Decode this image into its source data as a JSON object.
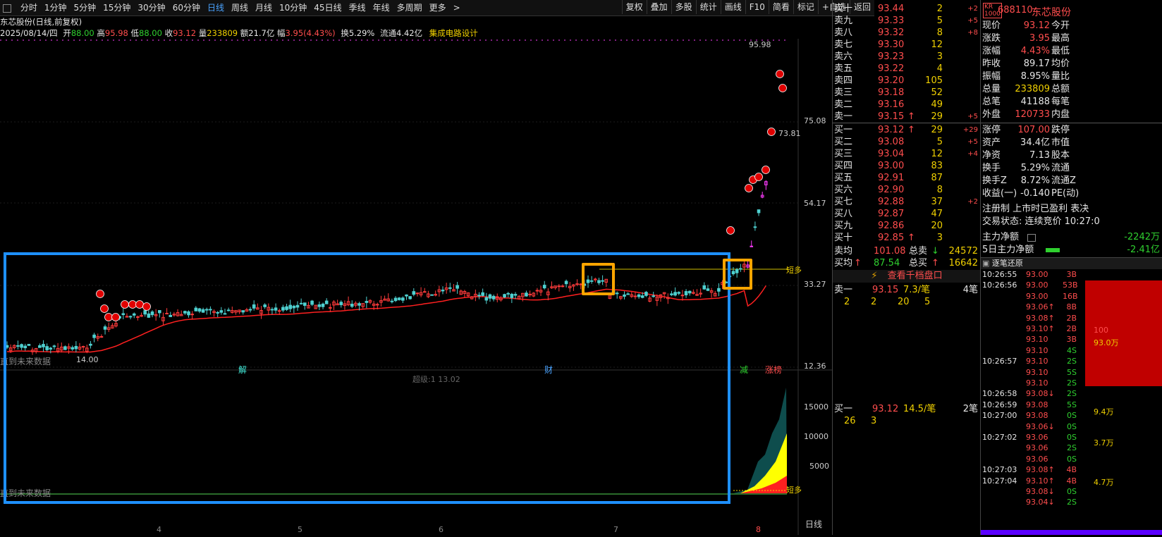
{
  "toolbar": {
    "timeframes": [
      "分时",
      "1分钟",
      "5分钟",
      "15分钟",
      "30分钟",
      "60分钟",
      "日线",
      "周线",
      "月线",
      "10分钟",
      "45日线",
      "季线",
      "年线",
      "多周期",
      "更多"
    ],
    "active_timeframe": "日线",
    "more_arrow": ">",
    "buttons": [
      "复权",
      "叠加",
      "多股",
      "统计",
      "画线",
      "F10",
      "简看",
      "标记",
      "+自选",
      "返回"
    ]
  },
  "info": {
    "stock_title": "东芯股份(日线,前复权)",
    "date": "2025/08/14/四",
    "open_label": "开",
    "open": "88.00",
    "high_label": "高",
    "high": "95.98",
    "low_label": "低",
    "low": "88.00",
    "close_label": "收",
    "close": "93.12",
    "vol_label": "量",
    "vol": "233809",
    "amount_label": "额",
    "amount": "21.7亿",
    "change_label": "幅",
    "change": "3.95(4.43%)",
    "turnover_label": "换",
    "turnover": "5.29%",
    "float_label": "流通",
    "float": "4.42亿",
    "industry": "集成电路设计"
  },
  "chart": {
    "price_ticks": [
      "75.08",
      "54.17",
      "33.27",
      "12.36"
    ],
    "vol_ticks": [
      "15000",
      "10000",
      "5000"
    ],
    "high_label": "95.98",
    "low_label": "14.00",
    "mark_price": "73.81",
    "future_data": "直到未来数据",
    "future_data2": "直到未来数据",
    "event_labels": [
      "解",
      "财",
      "减",
      "涨榜"
    ],
    "overlay_right": "短多",
    "overlay_right2": "短多",
    "vol_indicator": "超级:1 13.02",
    "period_label": "日线",
    "x_ticks": [
      "4",
      "5",
      "6",
      "7",
      "8"
    ],
    "candle_badge": "拒",
    "colors": {
      "up": "#ff3b3b",
      "down": "#2fd02f",
      "magenta": "#ff3bff",
      "ma": "#ff2020",
      "highlight_blue": "#1e90ff",
      "highlight_orange": "#ffa500",
      "area_dark": "#0e4d4d",
      "area_yellow": "#ffff00",
      "area_red": "#ff2020"
    }
  },
  "orderbook": {
    "asks": [
      {
        "label": "卖十",
        "price": "93.44",
        "vol": "2",
        "chg": "+2",
        "arrow": ""
      },
      {
        "label": "卖九",
        "price": "93.33",
        "vol": "5",
        "chg": "+5",
        "arrow": ""
      },
      {
        "label": "卖八",
        "price": "93.32",
        "vol": "8",
        "chg": "+8",
        "arrow": ""
      },
      {
        "label": "卖七",
        "price": "93.30",
        "vol": "12",
        "chg": "",
        "arrow": ""
      },
      {
        "label": "卖六",
        "price": "93.23",
        "vol": "3",
        "chg": "",
        "arrow": ""
      },
      {
        "label": "卖五",
        "price": "93.22",
        "vol": "4",
        "chg": "",
        "arrow": ""
      },
      {
        "label": "卖四",
        "price": "93.20",
        "vol": "105",
        "chg": "",
        "arrow": ""
      },
      {
        "label": "卖三",
        "price": "93.18",
        "vol": "52",
        "chg": "",
        "arrow": ""
      },
      {
        "label": "卖二",
        "price": "93.16",
        "vol": "49",
        "chg": "",
        "arrow": ""
      },
      {
        "label": "卖一",
        "price": "93.15",
        "vol": "29",
        "chg": "+5",
        "arrow": "↑"
      }
    ],
    "bids": [
      {
        "label": "买一",
        "price": "93.12",
        "vol": "29",
        "chg": "+29",
        "arrow": "↑"
      },
      {
        "label": "买二",
        "price": "93.08",
        "vol": "5",
        "chg": "+5",
        "arrow": ""
      },
      {
        "label": "买三",
        "price": "93.04",
        "vol": "12",
        "chg": "+4",
        "arrow": ""
      },
      {
        "label": "买四",
        "price": "93.00",
        "vol": "83",
        "chg": "",
        "arrow": ""
      },
      {
        "label": "买五",
        "price": "92.91",
        "vol": "87",
        "chg": "",
        "arrow": ""
      },
      {
        "label": "买六",
        "price": "92.90",
        "vol": "8",
        "chg": "",
        "arrow": ""
      },
      {
        "label": "买七",
        "price": "92.88",
        "vol": "37",
        "chg": "+2",
        "arrow": ""
      },
      {
        "label": "买八",
        "price": "92.87",
        "vol": "47",
        "chg": "",
        "arrow": ""
      },
      {
        "label": "买九",
        "price": "92.86",
        "vol": "20",
        "chg": "",
        "arrow": ""
      },
      {
        "label": "买十",
        "price": "92.85",
        "vol": "3",
        "chg": "",
        "arrow": "↑"
      }
    ],
    "ask_avg_label": "卖均",
    "ask_avg": "101.08",
    "total_sell_label": "总卖",
    "total_sell": "24572",
    "bid_avg_label": "买均",
    "bid_avg": "87.54",
    "total_buy_label": "总买",
    "total_buy": "16642",
    "view_thousand": "查看千档盘口",
    "sell1_label": "卖一",
    "sell1_price": "93.15",
    "sell1_per": "7.3/笔",
    "sell1_count": "4笔",
    "sell1_queue": [
      "2",
      "2",
      "20",
      "5"
    ],
    "buy1_label": "买一",
    "buy1_price": "93.12",
    "buy1_per": "14.5/笔",
    "buy1_count": "2笔",
    "buy1_queue": [
      "26",
      "3"
    ]
  },
  "right": {
    "badge_top": "KR",
    "badge_bottom": "1000",
    "code": "688110",
    "name": "东芯股份",
    "rows": [
      {
        "l": "现价",
        "v": "93.12",
        "vc": "red",
        "r": "今开"
      },
      {
        "l": "涨跌",
        "v": "3.95",
        "vc": "red",
        "r": "最高"
      },
      {
        "l": "涨幅",
        "v": "4.43%",
        "vc": "red",
        "r": "最低"
      },
      {
        "l": "昨收",
        "v": "89.17",
        "vc": "white",
        "r": "均价"
      },
      {
        "l": "振幅",
        "v": "8.95%",
        "vc": "white",
        "r": "量比"
      },
      {
        "l": "总量",
        "v": "233809",
        "vc": "yellow",
        "r": "总额"
      },
      {
        "l": "总笔",
        "v": "41188",
        "vc": "white",
        "r": "每笔"
      },
      {
        "l": "外盘",
        "v": "120733",
        "vc": "red",
        "r": "内盘"
      }
    ],
    "rows2": [
      {
        "l": "涨停",
        "v": "107.00",
        "vc": "red",
        "r": "跌停"
      },
      {
        "l": "资产",
        "v": "34.4亿",
        "vc": "white",
        "r": "市值"
      },
      {
        "l": "净资",
        "v": "7.13",
        "vc": "white",
        "r": "股本"
      },
      {
        "l": "换手",
        "v": "5.29%",
        "vc": "white",
        "r": "流通"
      },
      {
        "l": "换手Z",
        "v": "8.72%",
        "vc": "white",
        "r": "流通Z"
      },
      {
        "l": "收益(一)",
        "v": "-0.140",
        "vc": "white",
        "r": "PE(动)"
      }
    ],
    "tags": "注册制 上市时已盈利 表决",
    "trade_status": "交易状态: 连续竞价 10:27:0",
    "main_net_label": "主力净额",
    "main_net": "-2242万",
    "main5_label": "5日主力净额",
    "main5": "-2.41亿",
    "ticks_title": "逐笔还原",
    "ticks": [
      {
        "t": "10:26:55",
        "p": "93.00",
        "pc": "red",
        "v": "3B",
        "vc": "red"
      },
      {
        "t": "10:26:56",
        "p": "93.00",
        "pc": "red",
        "v": "53B",
        "vc": "red"
      },
      {
        "t": "",
        "p": "93.00",
        "pc": "red",
        "v": "16B",
        "vc": "red"
      },
      {
        "t": "",
        "p": "93.06↑",
        "pc": "red",
        "v": "8B",
        "vc": "red"
      },
      {
        "t": "",
        "p": "93.08↑",
        "pc": "red",
        "v": "2B",
        "vc": "red"
      },
      {
        "t": "",
        "p": "93.10↑",
        "pc": "red",
        "v": "2B",
        "vc": "red"
      },
      {
        "t": "",
        "p": "93.10",
        "pc": "red",
        "v": "3B",
        "vc": "red"
      },
      {
        "t": "",
        "p": "93.10",
        "pc": "red",
        "v": "4S",
        "vc": "green"
      },
      {
        "t": "10:26:57",
        "p": "93.10",
        "pc": "red",
        "v": "2S",
        "vc": "green"
      },
      {
        "t": "",
        "p": "93.10",
        "pc": "red",
        "v": "5S",
        "vc": "green"
      },
      {
        "t": "",
        "p": "93.10",
        "pc": "red",
        "v": "2S",
        "vc": "green"
      },
      {
        "t": "10:26:58",
        "p": "93.08↓",
        "pc": "red",
        "v": "2S",
        "vc": "green"
      },
      {
        "t": "10:26:59",
        "p": "93.08",
        "pc": "red",
        "v": "5S",
        "vc": "green"
      },
      {
        "t": "10:27:00",
        "p": "93.08",
        "pc": "red",
        "v": "0S",
        "vc": "green"
      },
      {
        "t": "",
        "p": "93.06↓",
        "pc": "red",
        "v": "0S",
        "vc": "green"
      },
      {
        "t": "10:27:02",
        "p": "93.06",
        "pc": "red",
        "v": "0S",
        "vc": "green"
      },
      {
        "t": "",
        "p": "93.06",
        "pc": "red",
        "v": "2S",
        "vc": "green"
      },
      {
        "t": "",
        "p": "93.06",
        "pc": "red",
        "v": "0S",
        "vc": "green"
      },
      {
        "t": "10:27:03",
        "p": "93.08↑",
        "pc": "red",
        "v": "4B",
        "vc": "red"
      },
      {
        "t": "10:27:04",
        "p": "93.10↑",
        "pc": "red",
        "v": "4B",
        "vc": "red"
      },
      {
        "t": "",
        "p": "93.08↓",
        "pc": "red",
        "v": "0S",
        "vc": "green"
      },
      {
        "t": "",
        "p": "93.04↓",
        "pc": "red",
        "v": "2S",
        "vc": "green"
      }
    ],
    "side_values": [
      "100",
      "93.0万",
      "9.4万",
      "3.7万",
      "4.7万"
    ]
  }
}
